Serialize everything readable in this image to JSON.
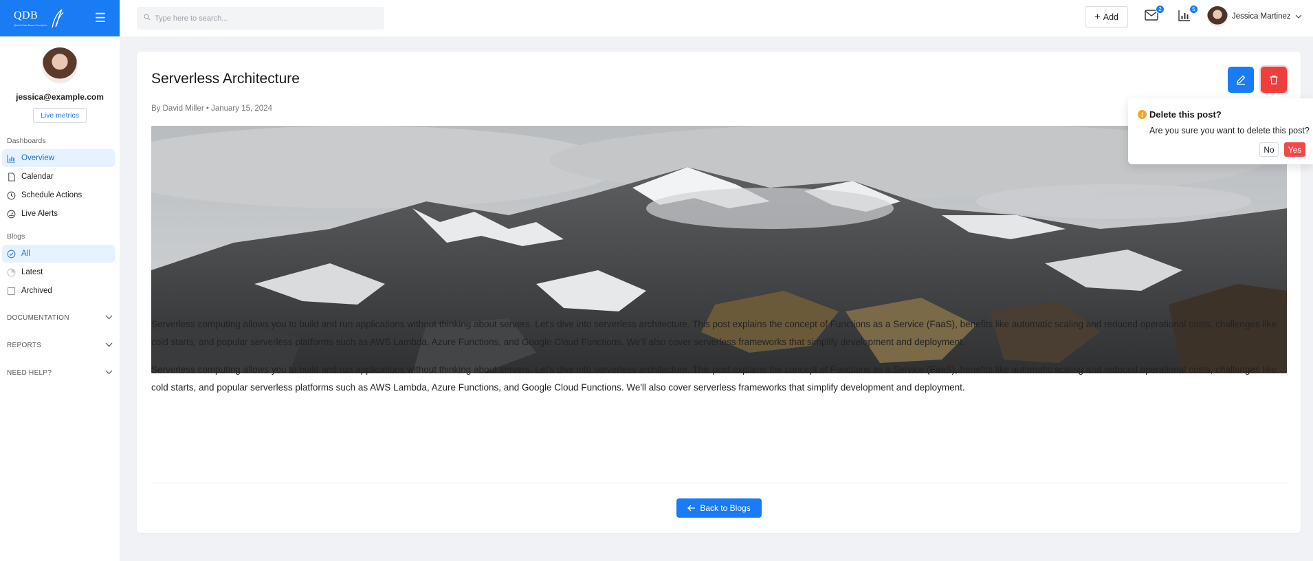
{
  "brand": {
    "name": "QDB",
    "tagline": "Quick Data Board Analytics"
  },
  "sidebar": {
    "email": "jessica@example.com",
    "live_metrics": "Live metrics",
    "dashboards_title": "Dashboards",
    "dashboards": [
      {
        "label": "Overview",
        "icon": "chart-icon",
        "active": true
      },
      {
        "label": "Calendar",
        "icon": "file-icon",
        "active": false
      },
      {
        "label": "Schedule Actions",
        "icon": "clock-icon",
        "active": false
      },
      {
        "label": "Live Alerts",
        "icon": "gauge-icon",
        "active": false
      }
    ],
    "blogs_title": "Blogs",
    "blogs": [
      {
        "label": "All",
        "icon": "check-circle-icon",
        "active": true
      },
      {
        "label": "Latest",
        "icon": "pie-icon",
        "active": false
      },
      {
        "label": "Archived",
        "icon": "square-icon",
        "active": false
      }
    ],
    "sections": [
      "DOCUMENTATION",
      "REPORTS",
      "NEED HELP?"
    ]
  },
  "topbar": {
    "search_placeholder": "Type here to search...",
    "add_label": "Add",
    "mail_count": "2",
    "chart_count": "5",
    "user_name": "Jessica Martinez"
  },
  "post": {
    "title": "Serverless Architecture",
    "meta": "By David Miller • January 15, 2024",
    "paragraphs": [
      "Serverless computing allows you to build and run applications without thinking about servers. Let's dive into serverless architecture. This post explains the concept of Functions as a Service (FaaS), benefits like automatic scaling and reduced operational costs, challenges like cold starts, and popular serverless platforms such as AWS Lambda, Azure Functions, and Google Cloud Functions. We'll also cover serverless frameworks that simplify development and deployment.",
      "Serverless computing allows you to build and run applications without thinking about servers. Let's dive into serverless architecture. This post explains the concept of Functions as a Service (FaaS), benefits like automatic scaling and reduced operational costs, challenges like cold starts, and popular serverless platforms such as AWS Lambda, Azure Functions, and Google Cloud Functions. We'll also cover serverless frameworks that simplify development and deployment."
    ],
    "back_label": "Back to Blogs"
  },
  "popconfirm": {
    "title": "Delete this post?",
    "message": "Are you sure you want to delete this post?",
    "no": "No",
    "yes": "Yes"
  },
  "colors": {
    "primary": "#1a7cf4",
    "danger": "#ef3e3e",
    "warning": "#f5a623"
  }
}
